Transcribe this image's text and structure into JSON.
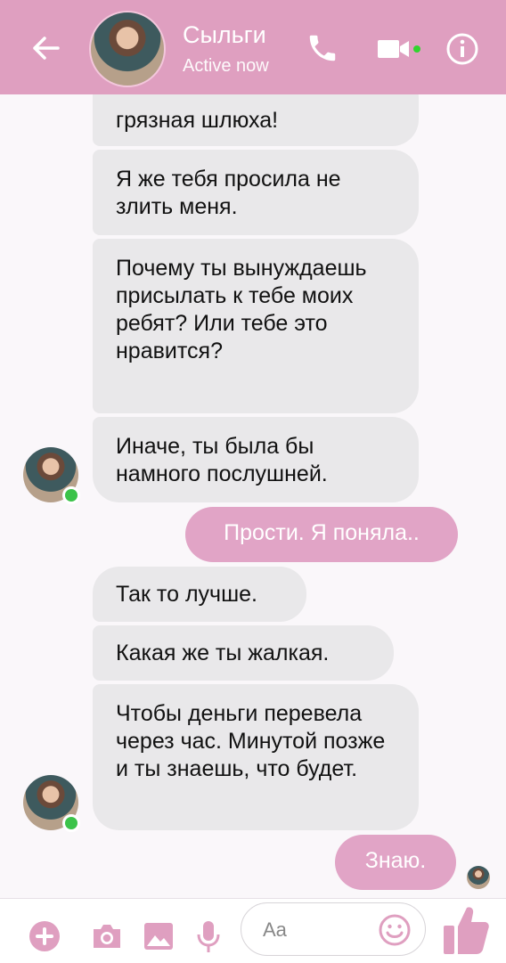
{
  "header": {
    "name": "Сыльги",
    "status": "Active now",
    "icons": [
      "back-arrow-icon",
      "avatar",
      "phone-icon",
      "video-camera-icon",
      "info-icon"
    ],
    "accent": "#df9fc0"
  },
  "messages": [
    {
      "side": "in",
      "text": "грязная шлюха!"
    },
    {
      "side": "in",
      "text": "Я же тебя просила не злить меня."
    },
    {
      "side": "in",
      "text": "Почему ты вынуждаешь присылать к тебе моих ребят? Или тебе это нравится?"
    },
    {
      "side": "in",
      "text": "Иначе, ты была бы намного послушней."
    },
    {
      "side": "out",
      "text": "Прости. Я поняла.."
    },
    {
      "side": "in",
      "text": "Так то лучше."
    },
    {
      "side": "in",
      "text": "Какая же ты жалкая."
    },
    {
      "side": "in",
      "text": "Чтобы деньги перевела через час. Минутой позже и ты знаешь, что будет."
    },
    {
      "side": "out",
      "text": "Знаю."
    }
  ],
  "composer": {
    "placeholder": "Aa",
    "icons": [
      "plus-icon",
      "camera-icon",
      "image-icon",
      "microphone-icon",
      "emoji-icon",
      "thumbs-up-icon"
    ]
  },
  "colors": {
    "incoming_bubble": "#e9e8ea",
    "outgoing_bubble": "#e1a4c6",
    "online": "#3cc34a"
  }
}
